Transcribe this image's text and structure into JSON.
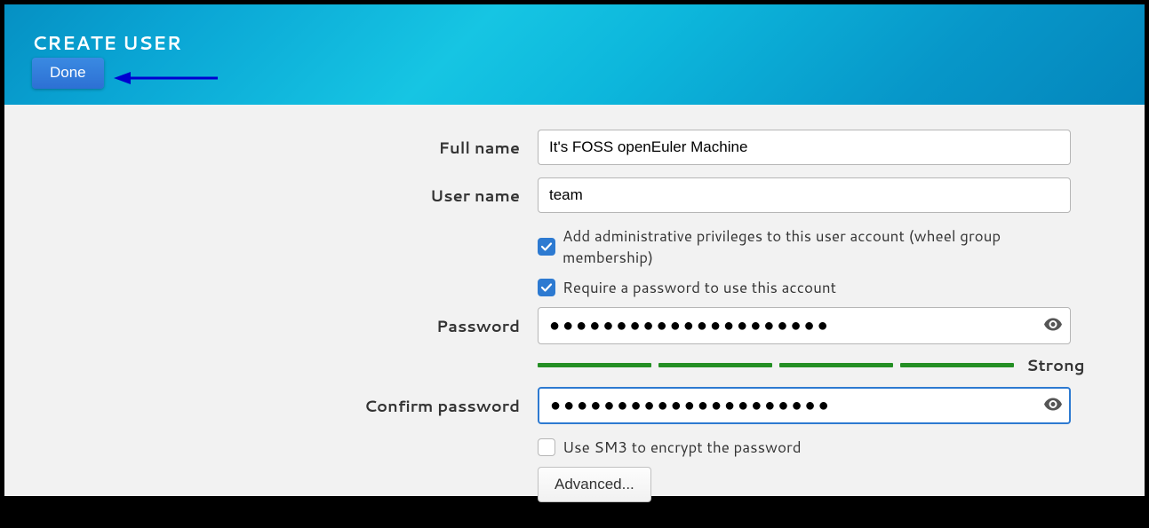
{
  "header": {
    "title": "CREATE USER",
    "done_label": "Done"
  },
  "form": {
    "full_name_label": "Full name",
    "full_name_value": "It's FOSS openEuler Machine",
    "user_name_label": "User name",
    "user_name_value": "team",
    "admin_checkbox_label": "Add administrative privileges to this user account (wheel group membership)",
    "admin_checked": true,
    "require_pw_label": "Require a password to use this account",
    "require_pw_checked": true,
    "password_label": "Password",
    "password_value": "●●●●●●●●●●●●●●●●●●●●●",
    "confirm_label": "Confirm password",
    "confirm_value": "●●●●●●●●●●●●●●●●●●●●●",
    "strength_label": "Strong",
    "sm3_label": "Use SM3 to encrypt the password",
    "sm3_checked": false,
    "advanced_label": "Advanced..."
  },
  "colors": {
    "accent": "#2d7ad1",
    "strength_bar": "#248f24"
  }
}
